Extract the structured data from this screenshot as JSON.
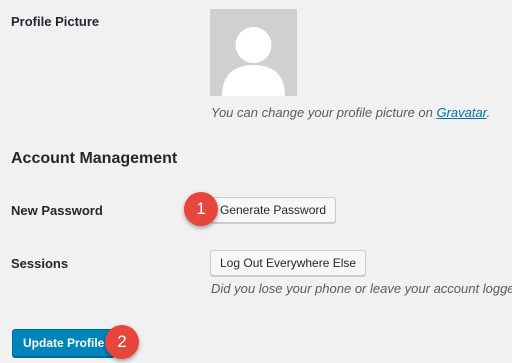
{
  "profile_picture": {
    "label": "Profile Picture",
    "description_prefix": "You can change your profile picture on ",
    "gravatar_link": "Gravatar",
    "description_suffix": "."
  },
  "account_management": {
    "heading": "Account Management",
    "new_password": {
      "label": "New Password",
      "button": "Generate Password"
    },
    "sessions": {
      "label": "Sessions",
      "button": "Log Out Everywhere Else",
      "description": "Did you lose your phone or leave your account logged in at a public computer?"
    }
  },
  "update_button": "Update Profile",
  "markers": [
    "1",
    "2"
  ],
  "colors": {
    "primary": "#0085ba",
    "link": "#0073aa",
    "marker": "#e8453c",
    "background": "#f1f1f1"
  }
}
